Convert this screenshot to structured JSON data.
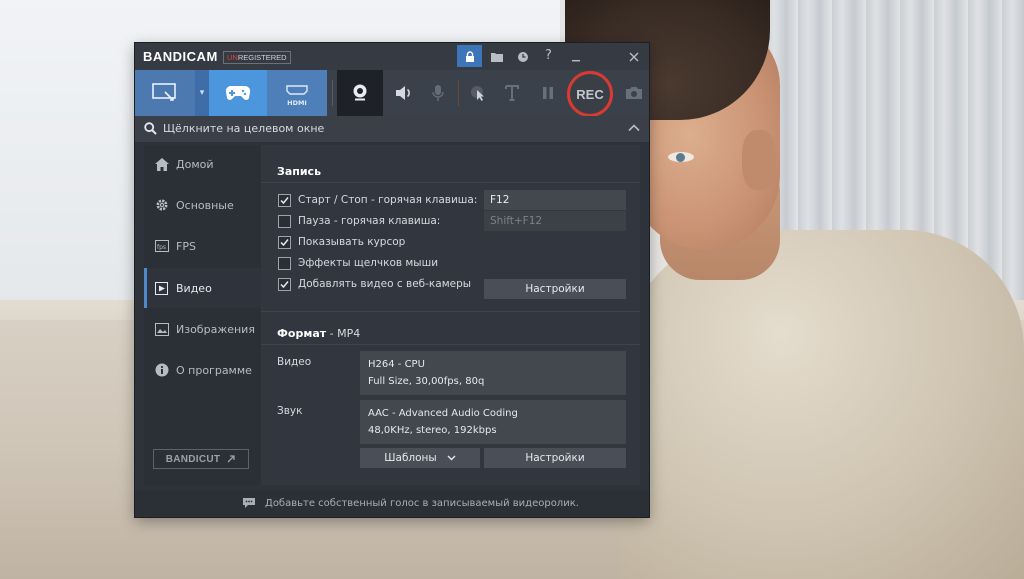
{
  "app": {
    "logo": "BANDICAM",
    "license_prefix": "UN",
    "license_rest": "REGISTERED"
  },
  "titlebar_icons": [
    "lock-icon",
    "folder-icon",
    "clock-icon",
    "help-icon",
    "minimize-icon",
    "close-icon"
  ],
  "toolbar": {
    "hdmi_label": "HDMI",
    "rec_label": "REC"
  },
  "search": {
    "text": "Щёлкните на целевом окне"
  },
  "sidebar": {
    "items": [
      {
        "label": "Домой",
        "icon": "home-icon"
      },
      {
        "label": "Основные",
        "icon": "gear-icon"
      },
      {
        "label": "FPS",
        "icon": "fps-icon"
      },
      {
        "label": "Видео",
        "icon": "video-icon"
      },
      {
        "label": "Изображения",
        "icon": "image-icon"
      },
      {
        "label": "О программе",
        "icon": "info-icon"
      }
    ],
    "active": "Видео",
    "bandicut": "BANDICUT"
  },
  "record": {
    "title": "Запись",
    "options": [
      {
        "label": "Старт / Стоп - горячая клавиша:",
        "checked": true
      },
      {
        "label": "Пауза - горячая клавиша:",
        "checked": false
      },
      {
        "label": "Показывать курсор",
        "checked": true
      },
      {
        "label": "Эффекты щелчков мыши",
        "checked": false
      },
      {
        "label": "Добавлять видео с веб-камеры",
        "checked": true
      }
    ],
    "start_stop_key": "F12",
    "pause_key": "Shift+F12",
    "settings_button": "Настройки"
  },
  "format": {
    "title": "Формат",
    "value": " - MP4",
    "video_label": "Видео",
    "video_line1": "H264 - CPU",
    "video_line2": "Full Size, 30,00fps, 80q",
    "audio_label": "Звук",
    "audio_line1": "AAC - Advanced Audio Coding",
    "audio_line2": "48,0KHz, stereo, 192kbps",
    "templates_button": "Шаблоны",
    "settings_button": "Настройки"
  },
  "footer": {
    "message": "Добавьте собственный голос в записываемый видеоролик."
  },
  "colors": {
    "accent_blue": "#4b96dc",
    "rec_red": "#d93b32",
    "window_bg": "#2e323a"
  }
}
